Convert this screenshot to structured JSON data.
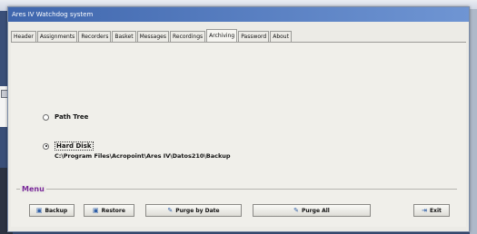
{
  "window": {
    "title": "Ares IV Watchdog system"
  },
  "tabs": [
    {
      "label": "Header"
    },
    {
      "label": "Assignments"
    },
    {
      "label": "Recorders"
    },
    {
      "label": "Basket"
    },
    {
      "label": "Messages"
    },
    {
      "label": "Recordings"
    },
    {
      "label": "Archiving",
      "active": true
    },
    {
      "label": "Password"
    },
    {
      "label": "About"
    }
  ],
  "archiving": {
    "options": [
      {
        "label": "Path Tree",
        "selected": false
      },
      {
        "label": "Hard Disk",
        "selected": true
      }
    ],
    "path": "C:\\Program Files\\Acropoint\\Ares IV\\Datos210\\Backup"
  },
  "menu": {
    "title": "Menu",
    "buttons": [
      {
        "label": "Backup",
        "icon": "backup-icon"
      },
      {
        "label": "Restore",
        "icon": "restore-icon"
      },
      {
        "label": "Purge by Date",
        "icon": "purge-date-icon"
      },
      {
        "label": "Purge All",
        "icon": "purge-all-icon"
      },
      {
        "label": "Exit",
        "icon": "exit-icon"
      }
    ]
  },
  "colors": {
    "titlebar_start": "#3f66ad",
    "titlebar_end": "#6f95d3",
    "menu_title": "#7a2a9a"
  }
}
